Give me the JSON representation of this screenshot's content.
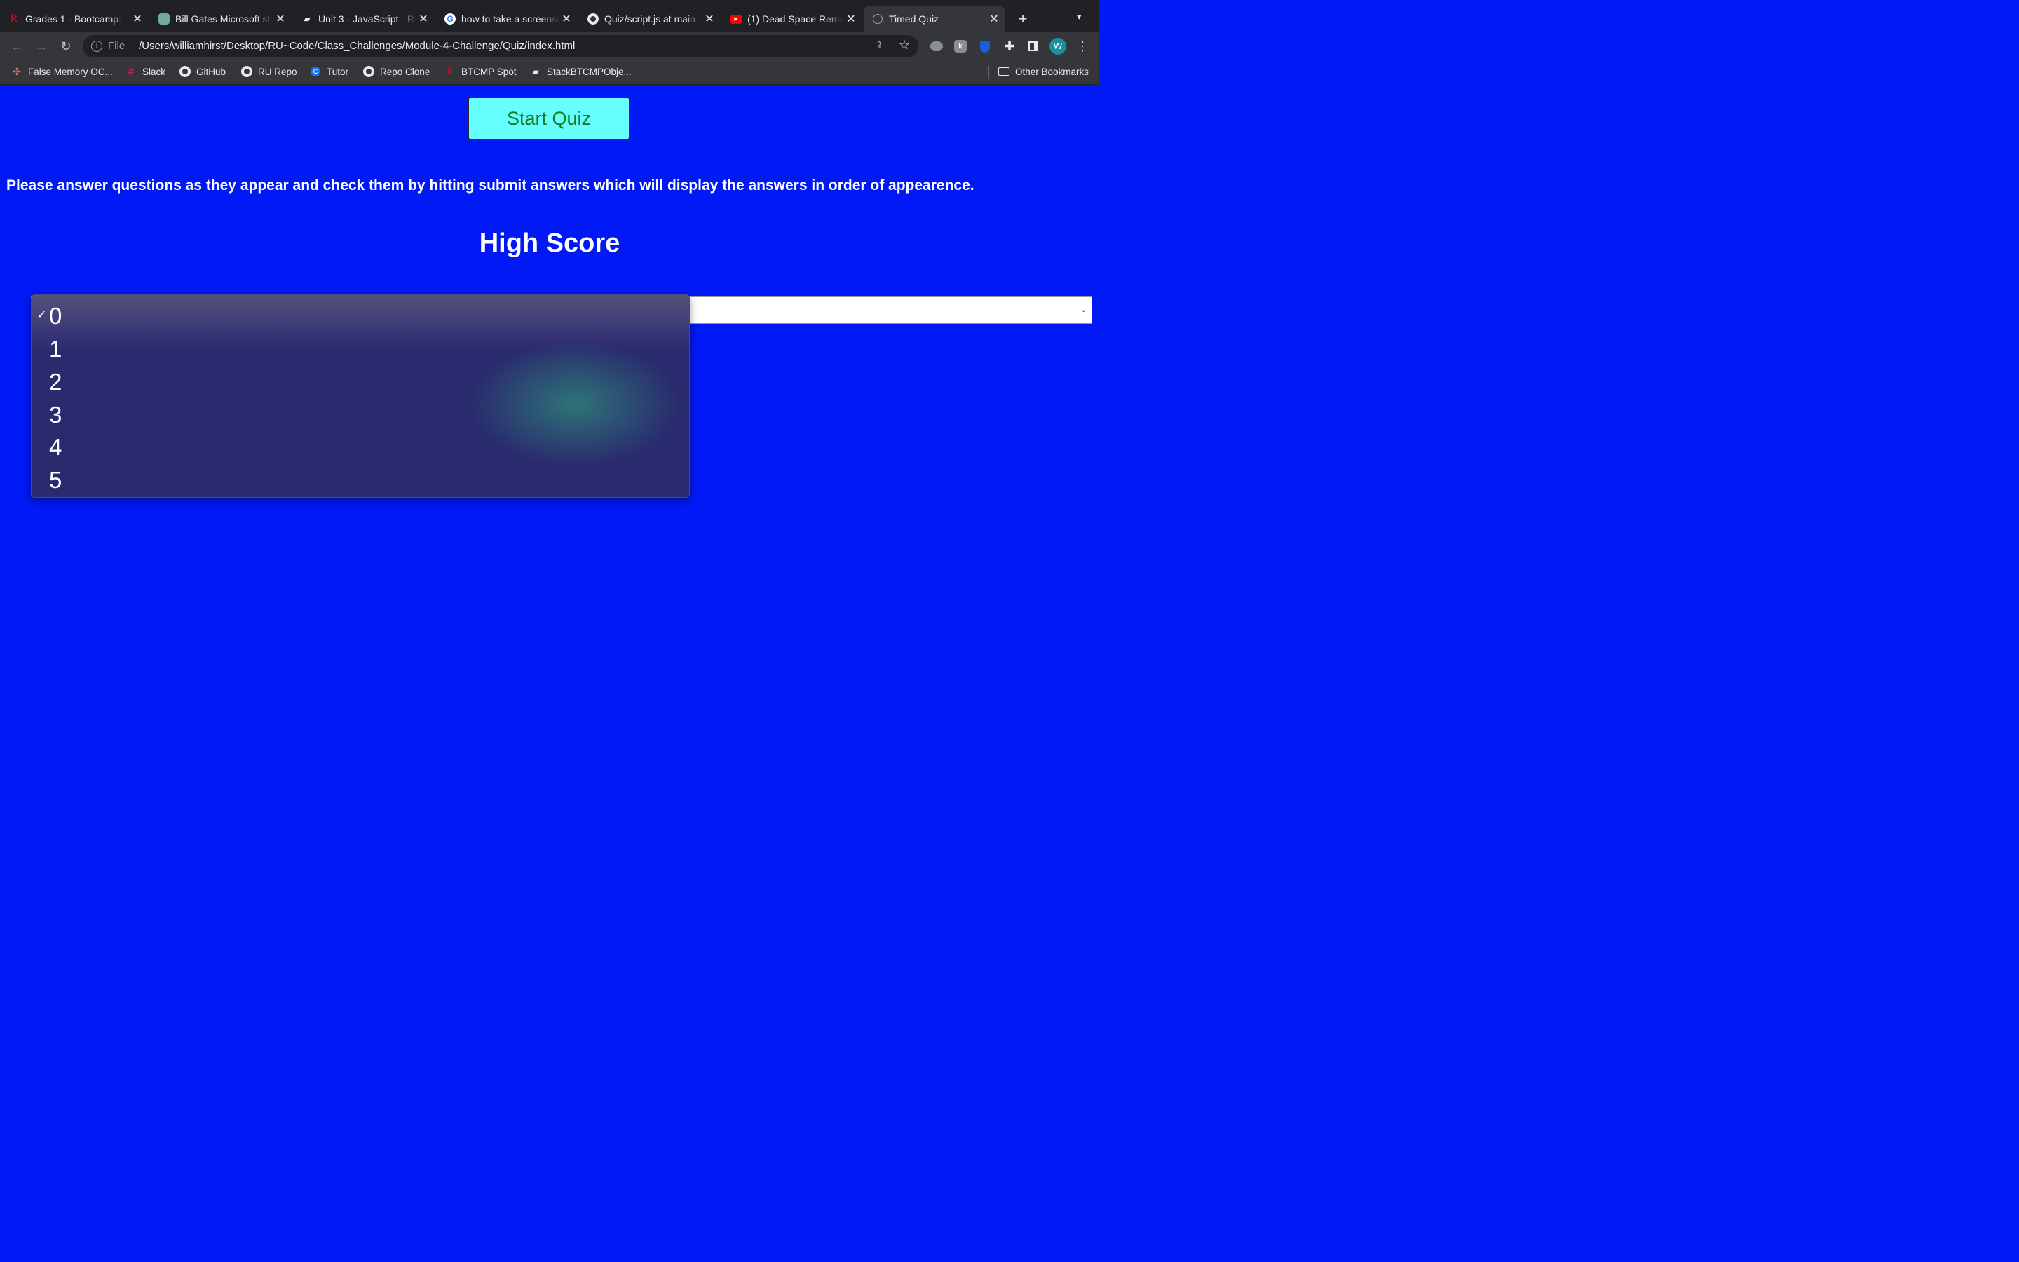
{
  "browser": {
    "tabs": [
      {
        "title": "Grades 1 - Bootcamp:",
        "icon": "r-logo-icon",
        "active": false
      },
      {
        "title": "Bill Gates Microsoft st",
        "icon": "chatgpt-icon",
        "active": false
      },
      {
        "title": "Unit 3 - JavaScript - R",
        "icon": "book-icon",
        "active": false
      },
      {
        "title": "how to take a screensh",
        "icon": "google-icon",
        "active": false
      },
      {
        "title": "Quiz/script.js at main",
        "icon": "github-icon",
        "active": false
      },
      {
        "title": "(1) Dead Space Rema",
        "icon": "youtube-icon",
        "active": false
      },
      {
        "title": "Timed Quiz",
        "icon": "globe-icon",
        "active": true
      }
    ],
    "omnibox": {
      "scheme_label": "File",
      "url": "/Users/williamhirst/Desktop/RU~Code/Class_Challenges/Module-4-Challenge/Quiz/index.html"
    },
    "profile_initial": "W",
    "bookmarks": [
      {
        "label": "False Memory OC...",
        "icon": "sparkle-icon"
      },
      {
        "label": "Slack",
        "icon": "slack-icon"
      },
      {
        "label": "GitHub",
        "icon": "github-icon"
      },
      {
        "label": "RU Repo",
        "icon": "github-icon"
      },
      {
        "label": "Tutor",
        "icon": "tutor-icon"
      },
      {
        "label": "Repo Clone",
        "icon": "github-icon"
      },
      {
        "label": "BTCMP Spot",
        "icon": "r-logo-icon"
      },
      {
        "label": "StackBTCMPObje...",
        "icon": "book-icon"
      }
    ],
    "other_bookmarks": "Other Bookmarks"
  },
  "page": {
    "start_button": "Start Quiz",
    "instructions": "Please answer questions as they appear and check them by hitting submit answers which will display the answers in order of appearence.",
    "high_score_title": "High Score",
    "select": {
      "selected": "0",
      "options": [
        "0",
        "1",
        "2",
        "3",
        "4",
        "5"
      ]
    }
  },
  "colors": {
    "page_bg": "#0019f5",
    "start_button_bg": "#66ffff",
    "start_button_text": "#1a7a22"
  }
}
